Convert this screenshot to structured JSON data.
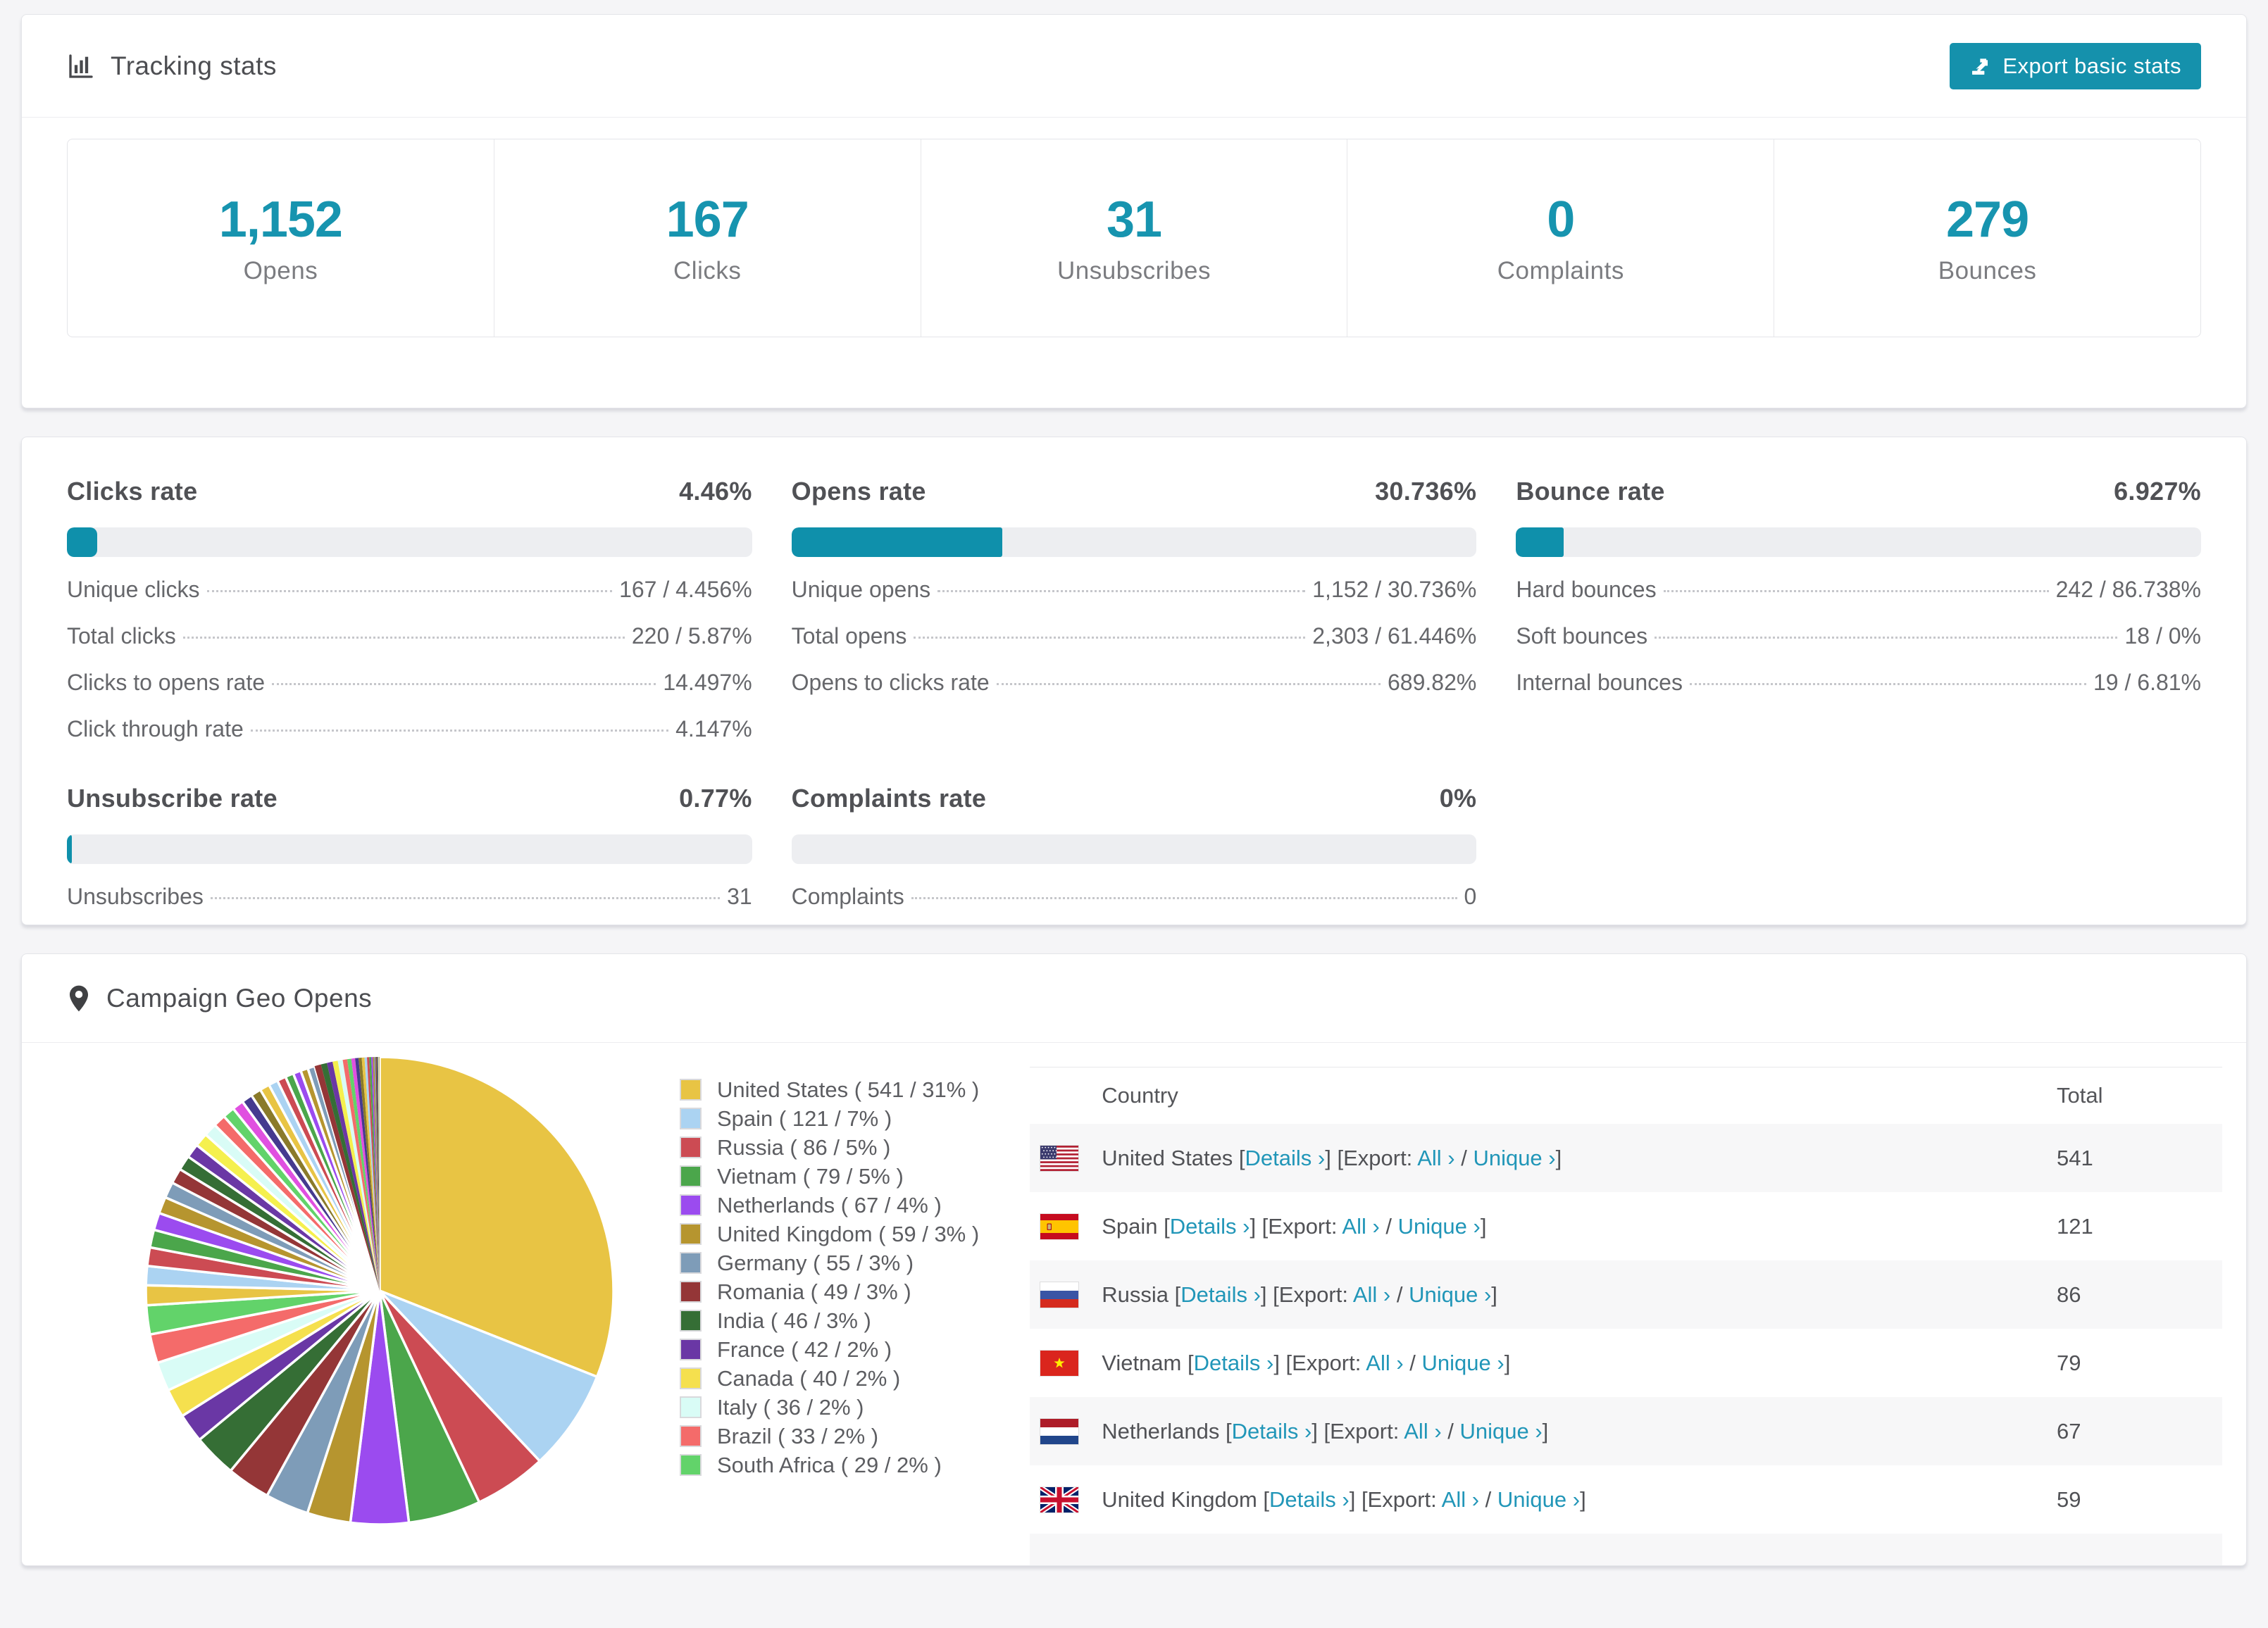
{
  "page": {
    "background": "#f5f5f7",
    "accent_teal": "#1591ac",
    "stat_number_color": "#1794af",
    "link_color": "#2196b8"
  },
  "tracking": {
    "title": "Tracking stats",
    "export_button": "Export basic stats",
    "stats": [
      {
        "value": "1,152",
        "label": "Opens"
      },
      {
        "value": "167",
        "label": "Clicks"
      },
      {
        "value": "31",
        "label": "Unsubscribes"
      },
      {
        "value": "0",
        "label": "Complaints"
      },
      {
        "value": "279",
        "label": "Bounces"
      }
    ]
  },
  "rates": [
    {
      "title": "Clicks rate",
      "value": "4.46%",
      "percent": 4.46,
      "rows": [
        [
          "Unique clicks",
          "167 / 4.456%"
        ],
        [
          "Total clicks",
          "220 / 5.87%"
        ],
        [
          "Clicks to opens rate",
          "14.497%"
        ],
        [
          "Click through rate",
          "4.147%"
        ]
      ]
    },
    {
      "title": "Opens rate",
      "value": "30.736%",
      "percent": 30.736,
      "rows": [
        [
          "Unique opens",
          "1,152 / 30.736%"
        ],
        [
          "Total opens",
          "2,303 / 61.446%"
        ],
        [
          "Opens to clicks rate",
          "689.82%"
        ]
      ]
    },
    {
      "title": "Bounce rate",
      "value": "6.927%",
      "percent": 6.927,
      "rows": [
        [
          "Hard bounces",
          "242 / 86.738%"
        ],
        [
          "Soft bounces",
          "18 / 0%"
        ],
        [
          "Internal bounces",
          "19 / 6.81%"
        ]
      ]
    },
    {
      "title": "Unsubscribe rate",
      "value": "0.77%",
      "percent": 0.77,
      "rows": [
        [
          "Unsubscribes",
          "31"
        ]
      ]
    },
    {
      "title": "Complaints rate",
      "value": "0%",
      "percent": 0,
      "rows": [
        [
          "Complaints",
          "0"
        ]
      ]
    }
  ],
  "geo": {
    "title": "Campaign Geo Opens",
    "table": {
      "columns": [
        "Country",
        "Total"
      ],
      "link_labels": {
        "details": "Details",
        "export": "Export:",
        "all": "All",
        "unique": "Unique",
        "chevron": "›"
      },
      "rows": [
        {
          "country": "United States",
          "flag": "us",
          "total": "541"
        },
        {
          "country": "Spain",
          "flag": "es",
          "total": "121"
        },
        {
          "country": "Russia",
          "flag": "ru",
          "total": "86"
        },
        {
          "country": "Vietnam",
          "flag": "vn",
          "total": "79"
        },
        {
          "country": "Netherlands",
          "flag": "nl",
          "total": "67"
        },
        {
          "country": "United Kingdom",
          "flag": "gb",
          "total": "59"
        }
      ],
      "partial_row": {
        "flag": "de"
      }
    }
  },
  "chart_data": {
    "type": "pie",
    "title": "Campaign Geo Opens",
    "legend_position": "right",
    "start_angle_deg": 0,
    "direction": "clockwise",
    "slices": [
      {
        "label": "United States",
        "value": 541,
        "percent": 31,
        "color": "#e8c444"
      },
      {
        "label": "Spain",
        "value": 121,
        "percent": 7,
        "color": "#abd3f2"
      },
      {
        "label": "Russia",
        "value": 86,
        "percent": 5,
        "color": "#cc4b53"
      },
      {
        "label": "Vietnam",
        "value": 79,
        "percent": 5,
        "color": "#4ba64b"
      },
      {
        "label": "Netherlands",
        "value": 67,
        "percent": 4,
        "color": "#9b4bef"
      },
      {
        "label": "United Kingdom",
        "value": 59,
        "percent": 3,
        "color": "#b6952f"
      },
      {
        "label": "Germany",
        "value": 55,
        "percent": 3,
        "color": "#7e9cb8"
      },
      {
        "label": "Romania",
        "value": 49,
        "percent": 3,
        "color": "#943637"
      },
      {
        "label": "India",
        "value": 46,
        "percent": 3,
        "color": "#356e35"
      },
      {
        "label": "France",
        "value": 42,
        "percent": 2,
        "color": "#6a37a5"
      },
      {
        "label": "Canada",
        "value": 40,
        "percent": 2,
        "color": "#f5e04e"
      },
      {
        "label": "Italy",
        "value": 36,
        "percent": 2,
        "color": "#d9fcf6"
      },
      {
        "label": "Brazil",
        "value": 33,
        "percent": 2,
        "color": "#f46b6a"
      },
      {
        "label": "South Africa",
        "value": 29,
        "percent": 2,
        "color": "#62d36a"
      }
    ],
    "others": {
      "percent": 26,
      "slice_count": 48,
      "note": "many small unlabeled country slices"
    },
    "others_palette": [
      "#e8c444",
      "#abd3f2",
      "#cc4b53",
      "#4ba64b",
      "#9b4bef",
      "#b6952f",
      "#7e9cb8",
      "#943637",
      "#356e35",
      "#6a37a5",
      "#f5f04e",
      "#d9fcf6",
      "#f46b6a",
      "#62d36a",
      "#e050e0",
      "#453a8f",
      "#8a7a2a"
    ]
  }
}
